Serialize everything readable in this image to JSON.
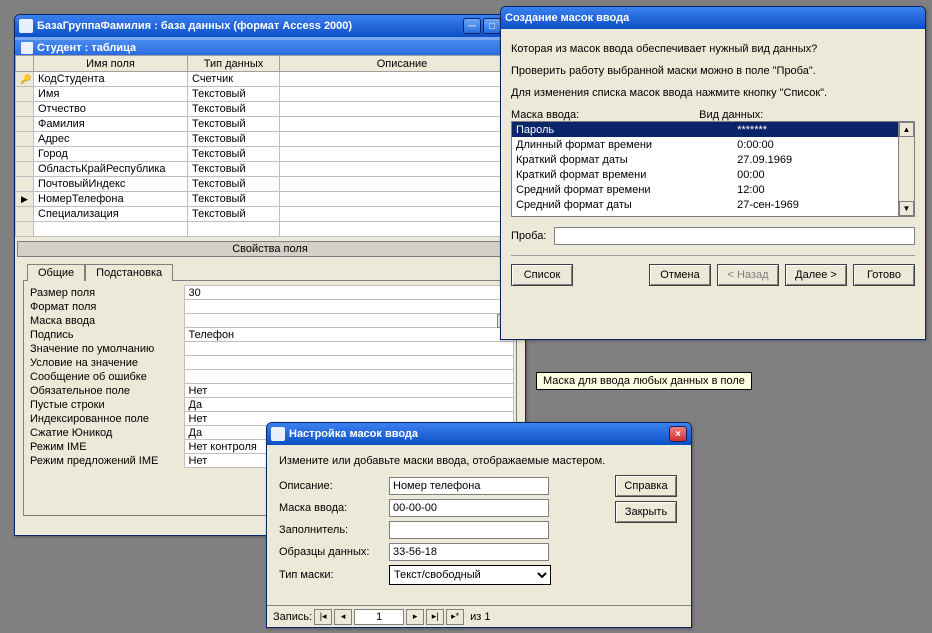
{
  "db_window": {
    "title": "БазаГруппаФамилия : база данных (формат Access 2000)",
    "subtitle": "Студент : таблица",
    "columns": {
      "name": "Имя поля",
      "type": "Тип данных",
      "desc": "Описание"
    },
    "rows": [
      {
        "marker": "key",
        "name": "КодСтудента",
        "type": "Счетчик"
      },
      {
        "marker": "",
        "name": "Имя",
        "type": "Текстовый"
      },
      {
        "marker": "",
        "name": "Отчество",
        "type": "Текстовый"
      },
      {
        "marker": "",
        "name": "Фамилия",
        "type": "Текстовый"
      },
      {
        "marker": "",
        "name": "Адрес",
        "type": "Текстовый"
      },
      {
        "marker": "",
        "name": "Город",
        "type": "Текстовый"
      },
      {
        "marker": "",
        "name": "ОбластьКрайРеспублика",
        "type": "Текстовый"
      },
      {
        "marker": "",
        "name": "ПочтовыйИндекс",
        "type": "Текстовый"
      },
      {
        "marker": "cur",
        "name": "НомерТелефона",
        "type": "Текстовый"
      },
      {
        "marker": "",
        "name": "Специализация",
        "type": "Текстовый"
      }
    ],
    "props_header": "Свойства поля",
    "tabs": {
      "general": "Общие",
      "lookup": "Подстановка"
    },
    "props": [
      {
        "label": "Размер поля",
        "value": "30"
      },
      {
        "label": "Формат поля",
        "value": ""
      },
      {
        "label": "Маска ввода",
        "value": "",
        "ellipsis": true
      },
      {
        "label": "Подпись",
        "value": "Телефон"
      },
      {
        "label": "Значение по умолчанию",
        "value": ""
      },
      {
        "label": "Условие на значение",
        "value": ""
      },
      {
        "label": "Сообщение об ошибке",
        "value": ""
      },
      {
        "label": "Обязательное поле",
        "value": "Нет"
      },
      {
        "label": "Пустые строки",
        "value": "Да"
      },
      {
        "label": "Индексированное поле",
        "value": "Нет"
      },
      {
        "label": "Сжатие Юникод",
        "value": "Да"
      },
      {
        "label": "Режим IME",
        "value": "Нет контроля"
      },
      {
        "label": "Режим предложений IME",
        "value": "Нет"
      }
    ]
  },
  "wizard": {
    "title": "Создание масок ввода",
    "q1": "Которая из масок ввода обеспечивает нужный вид данных?",
    "q2": "Проверить работу выбранной маски можно в поле \"Проба\".",
    "q3": "Для изменения списка масок ввода нажмите кнопку \"Список\".",
    "col_mask": "Маска ввода:",
    "col_view": "Вид данных:",
    "rows": [
      {
        "mask": "Пароль",
        "view": "*******",
        "sel": true
      },
      {
        "mask": "Длинный формат времени",
        "view": "0:00:00"
      },
      {
        "mask": "Краткий формат даты",
        "view": "27.09.1969"
      },
      {
        "mask": "Краткий формат времени",
        "view": "00:00"
      },
      {
        "mask": "Средний формат времени",
        "view": "12:00"
      },
      {
        "mask": "Средний формат даты",
        "view": "27-сен-1969"
      }
    ],
    "try_label": "Проба:",
    "btn_list": "Список",
    "btn_cancel": "Отмена",
    "btn_back": "< Назад",
    "btn_next": "Далее >",
    "btn_finish": "Готово"
  },
  "hint": "Маска для ввода любых данных в поле",
  "customize": {
    "title": "Настройка масок ввода",
    "instr": "Измените или добавьте маски ввода, отображаемые мастером.",
    "fields": {
      "desc_label": "Описание:",
      "desc_value": "Номер телефона",
      "mask_label": "Маска ввода:",
      "mask_value": "00-00-00",
      "fill_label": "Заполнитель:",
      "fill_value": "",
      "sample_label": "Образцы данных:",
      "sample_value": "33-56-18",
      "type_label": "Тип маски:",
      "type_value": "Текст/свободный"
    },
    "btn_help": "Справка",
    "btn_close": "Закрыть",
    "nav": {
      "label": "Запись:",
      "value": "1",
      "of": "из  1"
    }
  }
}
